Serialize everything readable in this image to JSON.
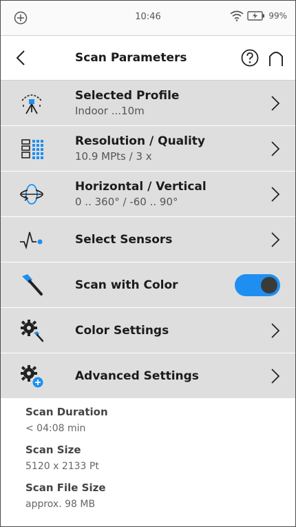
{
  "status_bar": {
    "time": "10:46",
    "battery": "99%"
  },
  "header": {
    "title": "Scan Parameters"
  },
  "menu": [
    {
      "label": "Selected Profile",
      "value": "Indoor ...10m",
      "icon": "tripod-scanner-icon"
    },
    {
      "label": "Resolution / Quality",
      "value": "10.9 MPts / 3 x",
      "icon": "grid-resolution-icon"
    },
    {
      "label": "Horizontal / Vertical",
      "value": "0 .. 360° / -60 .. 90°",
      "icon": "rotation-axes-icon"
    },
    {
      "label": "Select Sensors",
      "value": "",
      "icon": "sensor-signal-icon"
    },
    {
      "label": "Scan with Color",
      "value": "",
      "icon": "color-dropper-icon",
      "toggle": true
    },
    {
      "label": "Color Settings",
      "value": "",
      "icon": "gear-dropper-icon"
    },
    {
      "label": "Advanced Settings",
      "value": "",
      "icon": "gear-plus-icon"
    }
  ],
  "info": {
    "duration": {
      "label": "Scan Duration",
      "value": "< 04:08 min"
    },
    "size": {
      "label": "Scan Size",
      "value": "5120 x 2133 Pt"
    },
    "file_size": {
      "label": "Scan File Size",
      "value": "approx. 98 MB"
    }
  },
  "colors": {
    "accent": "#1e8ff0",
    "menu_bg": "#dedede",
    "text": "#1b1b1b"
  }
}
